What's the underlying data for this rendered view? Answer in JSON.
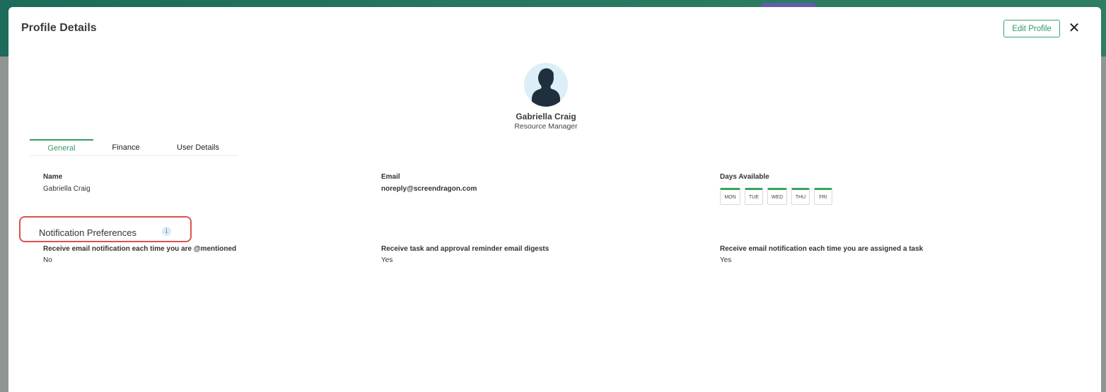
{
  "modal": {
    "title": "Profile Details",
    "edit_button": "Edit Profile",
    "close_glyph": "✕"
  },
  "profile": {
    "name": "Gabriella Craig",
    "role": "Resource Manager"
  },
  "tabs": [
    {
      "label": "General",
      "active": true
    },
    {
      "label": "Finance",
      "active": false
    },
    {
      "label": "User Details",
      "active": false
    }
  ],
  "general": {
    "name_label": "Name",
    "name_value": "Gabriella Craig",
    "email_label": "Email",
    "email_value": "noreply@screendragon.com",
    "days_label": "Days Available",
    "days": [
      "MON",
      "TUE",
      "WED",
      "THU",
      "FRI"
    ]
  },
  "notifications": {
    "title": "Notification Preferences",
    "info_glyph": "i",
    "items": [
      {
        "label": "Receive email notification each time you are @mentioned",
        "value": "No"
      },
      {
        "label": "Receive task and approval reminder email digests",
        "value": "Yes"
      },
      {
        "label": "Receive email notification each time you are assigned a task",
        "value": "Yes"
      }
    ]
  },
  "colors": {
    "accent_green": "#3a9a68",
    "day_bar_green": "#39a35b",
    "highlight_red": "#d9534f",
    "header_teal": "#1d6b5a"
  }
}
